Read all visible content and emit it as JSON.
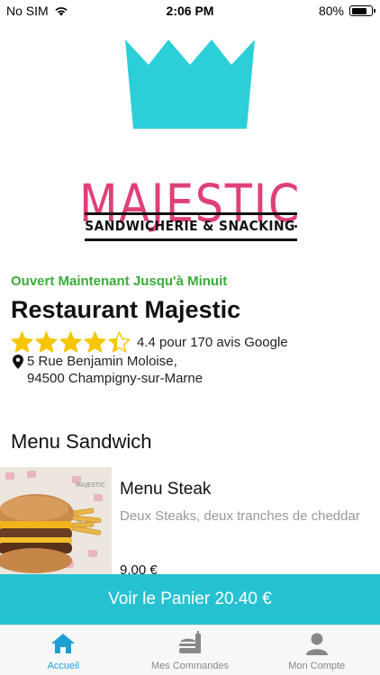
{
  "status_bar": {
    "carrier": "No SIM",
    "time": "2:06 PM",
    "battery_label": "80%",
    "battery_level": 0.8
  },
  "logo": {
    "brand_word": "MAJESTIC",
    "tagline": "SANDWICHERIE & SNACKING",
    "crown_color": "#2ccfd8",
    "brand_color": "#e0407a"
  },
  "restaurant": {
    "open_status": "Ouvert Maintenant Jusqu'à Minuit",
    "name": "Restaurant Majestic",
    "rating_value": 4.4,
    "rating_text": "4.4 pour 170 avis Google",
    "address_line1": "5 Rue Benjamin Moloise,",
    "address_line2": "94500 Champigny-sur-Marne"
  },
  "menu": {
    "section_title": "Menu Sandwich",
    "items": [
      {
        "name": "Menu Steak",
        "description": "Deux Steaks, deux tranches de cheddar",
        "price": "9.00 €"
      }
    ]
  },
  "cart": {
    "label": "Voir le Panier 20.40 €"
  },
  "tabs": [
    {
      "label": "Accueil",
      "icon": "home-icon",
      "active": true
    },
    {
      "label": "Mes Commandes",
      "icon": "orders-icon",
      "active": false
    },
    {
      "label": "Mon Compte",
      "icon": "account-icon",
      "active": false
    }
  ],
  "colors": {
    "accent": "#27c2d2",
    "open_green": "#3aab3a",
    "star_yellow": "#f7c600",
    "tab_active": "#1d9fd6"
  }
}
